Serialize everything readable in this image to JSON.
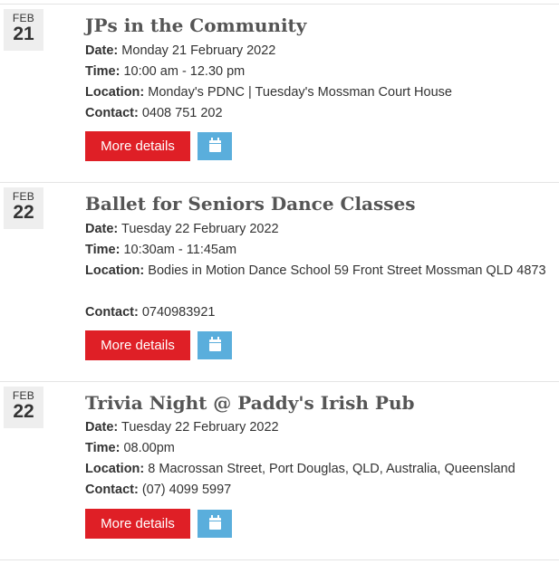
{
  "labels": {
    "date": "Date:",
    "time": "Time:",
    "location": "Location:",
    "contact": "Contact:"
  },
  "events": [
    {
      "month": "FEB",
      "day": "21",
      "title": "JPs in the Community",
      "date": "Monday 21 February 2022",
      "time": "10:00 am - 12.30 pm",
      "location": "Monday's PDNC | Tuesday's Mossman Court House",
      "contact": "0408 751 202",
      "more_label": "More details",
      "calendar_icon": "calendar-icon"
    },
    {
      "month": "FEB",
      "day": "22",
      "title": "Ballet for Seniors Dance Classes",
      "date": "Tuesday 22 February 2022",
      "time": "10:30am - 11:45am",
      "location": "Bodies in Motion Dance School 59 Front Street Mossman QLD 4873",
      "contact": "0740983921",
      "more_label": "More details",
      "calendar_icon": "calendar-icon"
    },
    {
      "month": "FEB",
      "day": "22",
      "title": "Trivia Night @ Paddy's Irish Pub",
      "date": "Tuesday 22 February 2022",
      "time": "08.00pm",
      "location": "8 Macrossan Street, Port Douglas, QLD, Australia, Queensland",
      "contact": "(07) 4099 5997",
      "more_label": "More details",
      "calendar_icon": "calendar-icon"
    }
  ],
  "colors": {
    "more_button": "#df1f26",
    "calendar_button": "#5aaedc",
    "date_box": "#eeeeee"
  }
}
